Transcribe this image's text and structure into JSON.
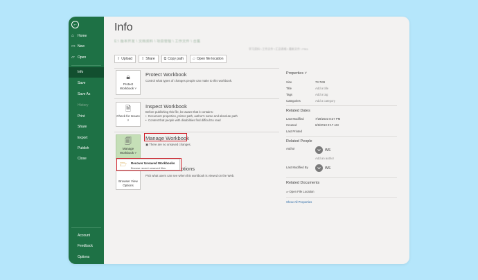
{
  "sidebar": {
    "back_icon": "back-arrow-icon",
    "items": [
      {
        "label": "Home",
        "icon": "home-icon"
      },
      {
        "label": "New",
        "icon": "new-file-icon"
      },
      {
        "label": "Open",
        "icon": "folder-open-icon"
      },
      {
        "label": "Info",
        "active": true
      },
      {
        "label": "Save"
      },
      {
        "label": "Save As"
      },
      {
        "label": "History",
        "disabled": true
      },
      {
        "label": "Print"
      },
      {
        "label": "Share"
      },
      {
        "label": "Export"
      },
      {
        "label": "Publish"
      },
      {
        "label": "Close"
      }
    ],
    "bottom_items": [
      {
        "label": "Account"
      },
      {
        "label": "Feedback"
      },
      {
        "label": "Options"
      }
    ]
  },
  "main": {
    "title": "Info",
    "path_text": "E:\\ 版本开发 \\ 文档资料 \\ 项目管理 \\ 工作文件 \\ 合集",
    "path_right_text": "学习资料 \\ 工作文件 \\ 汇总表格 \\ 最新文件 \\ Files",
    "actions": [
      {
        "label": "Upload",
        "icon": "upload-icon"
      },
      {
        "label": "Share",
        "icon": "share-icon"
      },
      {
        "label": "Copy path",
        "icon": "copy-path-icon"
      },
      {
        "label": "Open file location",
        "icon": "folder-icon"
      }
    ],
    "sections": {
      "protect": {
        "tile_label": "Protect Workbook ˅",
        "title": "Protect Workbook",
        "desc": "Control what types of changes people can make to this workbook."
      },
      "inspect": {
        "tile_label": "Check for Issues ˅",
        "title": "Inspect Workbook",
        "desc": "Before publishing this file, be aware that it contains:",
        "bullets": [
          "Document properties, printer path, author's name and absolute path",
          "Content that people with disabilities find difficult to read"
        ]
      },
      "manage": {
        "tile_label": "Manage Workbook ˅",
        "title": "Manage Workbook",
        "desc": "There are no unsaved changes."
      },
      "browser": {
        "tile_label": "Browser View Options",
        "title_suffix": "ptions",
        "desc": "Pick what users can see when this workbook is viewed on the Web."
      }
    },
    "menu": {
      "title": "Recover Unsaved Workbooks",
      "desc": "Browse recent unsaved files."
    }
  },
  "properties": {
    "header": "Properties ˅",
    "rows": [
      {
        "key": "Size",
        "value": "73.7KB",
        "muted": false
      },
      {
        "key": "Title",
        "value": "Add a title",
        "muted": true
      },
      {
        "key": "Tags",
        "value": "Add a tag",
        "muted": true
      },
      {
        "key": "Categories",
        "value": "Add a category",
        "muted": true
      }
    ],
    "related_dates": {
      "header": "Related Dates",
      "rows": [
        {
          "key": "Last Modified",
          "value": "7/28/2023 8:37 PM"
        },
        {
          "key": "Created",
          "value": "6/6/2013 2:17 AM"
        },
        {
          "key": "Last Printed",
          "value": ""
        }
      ]
    },
    "related_people": {
      "header": "Related People",
      "author_label": "Author",
      "author_initials": "W",
      "author_name": "WS",
      "add_author": "Add an author",
      "modified_label": "Last Modified By",
      "modified_initials": "W",
      "modified_name": "WS"
    },
    "related_documents": {
      "header": "Related Documents",
      "open_location": "Open File Location",
      "show_all": "Show All Properties"
    }
  },
  "colors": {
    "sidebar_bg": "#1e7145",
    "sidebar_active": "#124f2f",
    "highlight_red": "#d0202a",
    "backdrop": "#b5e6fb"
  }
}
